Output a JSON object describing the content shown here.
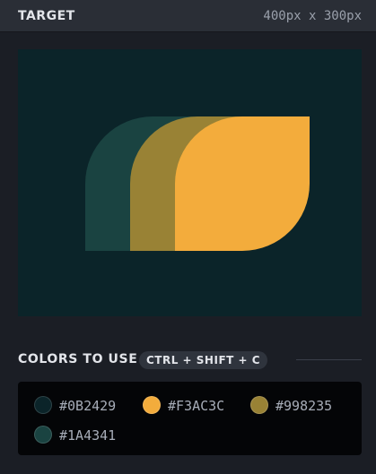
{
  "header": {
    "title": "TARGET",
    "size": "400px x 300px"
  },
  "target": {
    "background": "#0B2429",
    "shapes": [
      {
        "name": "back-leaf",
        "color": "#1A4341"
      },
      {
        "name": "middle-leaf",
        "color": "#998235"
      },
      {
        "name": "front-leaf",
        "color": "#F3AC3C"
      }
    ]
  },
  "colors_section": {
    "title": "COLORS TO USE",
    "shortcut": "CTRL + SHIFT + C"
  },
  "palette": [
    {
      "hex": "#0B2429",
      "label": "#0B2429"
    },
    {
      "hex": "#F3AC3C",
      "label": "#F3AC3C"
    },
    {
      "hex": "#998235",
      "label": "#998235"
    },
    {
      "hex": "#1A4341",
      "label": "#1A4341"
    }
  ]
}
